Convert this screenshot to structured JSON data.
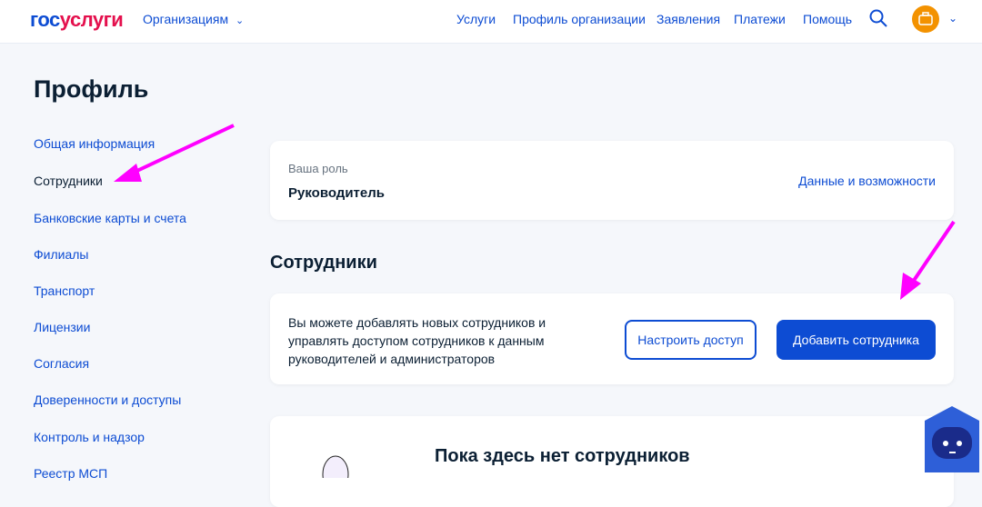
{
  "header": {
    "logo_a": "гос",
    "logo_b": "услуги",
    "org_menu": "Организациям",
    "nav": [
      "Услуги",
      "Профиль организации",
      "Заявления",
      "Платежи",
      "Помощь"
    ]
  },
  "page_title": "Профиль",
  "sidebar": [
    "Общая информация",
    "Сотрудники",
    "Банковские карты и счета",
    "Филиалы",
    "Транспорт",
    "Лицензии",
    "Согласия",
    "Доверенности и доступы",
    "Контроль и надзор",
    "Реестр МСП"
  ],
  "role": {
    "label": "Ваша роль",
    "value": "Руководитель",
    "link": "Данные и возможности"
  },
  "section_title": "Сотрудники",
  "info": {
    "text": "Вы можете добавлять новых сотрудников и управлять доступом сотрудников к данным руководителей и администраторов",
    "configure": "Настроить доступ",
    "add": "Добавить сотрудника"
  },
  "empty": {
    "title": "Пока здесь нет сотрудников"
  }
}
